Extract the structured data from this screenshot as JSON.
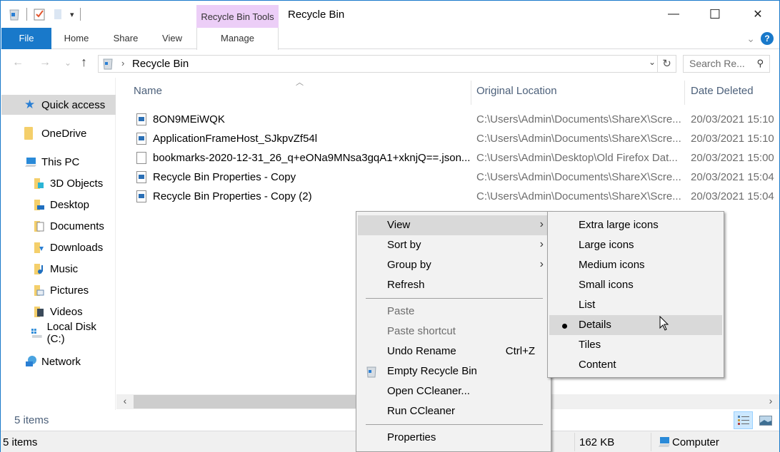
{
  "window": {
    "title": "Recycle Bin",
    "contextual_tab_group": "Recycle Bin Tools",
    "controls": {
      "minimize": "—",
      "maximize": "☐",
      "close": "✕"
    }
  },
  "ribbon": {
    "tabs": [
      {
        "label": "File"
      },
      {
        "label": "Home"
      },
      {
        "label": "Share"
      },
      {
        "label": "View"
      },
      {
        "label": "Manage"
      }
    ],
    "help": "?"
  },
  "navigation": {
    "back": "←",
    "forward": "→",
    "recent": "⌄",
    "up": "↑",
    "breadcrumb": [
      "Recycle Bin"
    ],
    "breadcrumb_separator": "›",
    "search_placeholder": "Search Re..."
  },
  "sidebar": {
    "items": [
      {
        "label": "Quick access",
        "icon": "quick-access-star-icon",
        "selected": true
      },
      {
        "label": "OneDrive",
        "icon": "onedrive-folder-icon"
      },
      {
        "label": "This PC",
        "icon": "this-pc-icon"
      },
      {
        "label": "3D Objects",
        "icon": "3d-objects-folder-icon"
      },
      {
        "label": "Desktop",
        "icon": "desktop-folder-icon"
      },
      {
        "label": "Documents",
        "icon": "documents-folder-icon"
      },
      {
        "label": "Downloads",
        "icon": "downloads-folder-icon"
      },
      {
        "label": "Music",
        "icon": "music-folder-icon"
      },
      {
        "label": "Pictures",
        "icon": "pictures-folder-icon"
      },
      {
        "label": "Videos",
        "icon": "videos-folder-icon"
      },
      {
        "label": "Local Disk (C:)",
        "icon": "local-disk-icon"
      },
      {
        "label": "Network",
        "icon": "network-icon"
      }
    ]
  },
  "file_list": {
    "columns": [
      "Name",
      "Original Location",
      "Date Deleted"
    ],
    "sort_indicator": "^",
    "rows": [
      {
        "name": "8ON9MEiWQK",
        "location": "C:\\Users\\Admin\\Documents\\ShareX\\Scre...",
        "date": "20/03/2021 15:10",
        "icon": "image-file-icon"
      },
      {
        "name": "ApplicationFrameHost_SJkpvZf54l",
        "location": "C:\\Users\\Admin\\Documents\\ShareX\\Scre...",
        "date": "20/03/2021 15:10",
        "icon": "image-file-icon"
      },
      {
        "name": "bookmarks-2020-12-31_26_q+eONa9MNsa3gqA1+xknjQ==.json...",
        "location": "C:\\Users\\Admin\\Desktop\\Old Firefox Dat...",
        "date": "20/03/2021 15:00",
        "icon": "blank-file-icon"
      },
      {
        "name": "Recycle Bin Properties - Copy",
        "location": "C:\\Users\\Admin\\Documents\\ShareX\\Scre...",
        "date": "20/03/2021 15:04",
        "icon": "image-file-icon"
      },
      {
        "name": "Recycle Bin Properties - Copy (2)",
        "location": "C:\\Users\\Admin\\Documents\\ShareX\\Scre...",
        "date": "20/03/2021 15:04",
        "icon": "image-file-icon"
      }
    ]
  },
  "footer": {
    "items_count": "5 items"
  },
  "statusbar": {
    "items": "5 items",
    "size": "162 KB",
    "location": "Computer"
  },
  "context_menu": {
    "items": [
      {
        "label": "View",
        "submenu": true,
        "highlighted": true
      },
      {
        "label": "Sort by",
        "submenu": true
      },
      {
        "label": "Group by",
        "submenu": true
      },
      {
        "label": "Refresh"
      },
      {
        "separator": true
      },
      {
        "label": "Paste",
        "disabled": true
      },
      {
        "label": "Paste shortcut",
        "disabled": true
      },
      {
        "label": "Undo Rename",
        "shortcut": "Ctrl+Z"
      },
      {
        "label": "Empty Recycle Bin",
        "icon": "recycle-bin-icon"
      },
      {
        "label": "Open CCleaner..."
      },
      {
        "label": "Run CCleaner"
      },
      {
        "separator": true
      },
      {
        "label": "Properties"
      }
    ],
    "submenu_arrow": "›"
  },
  "view_submenu": {
    "items": [
      {
        "label": "Extra large icons"
      },
      {
        "label": "Large icons"
      },
      {
        "label": "Medium icons"
      },
      {
        "label": "Small icons"
      },
      {
        "label": "List"
      },
      {
        "label": "Details",
        "checked": true,
        "highlighted": true
      },
      {
        "label": "Tiles"
      },
      {
        "label": "Content"
      }
    ]
  }
}
